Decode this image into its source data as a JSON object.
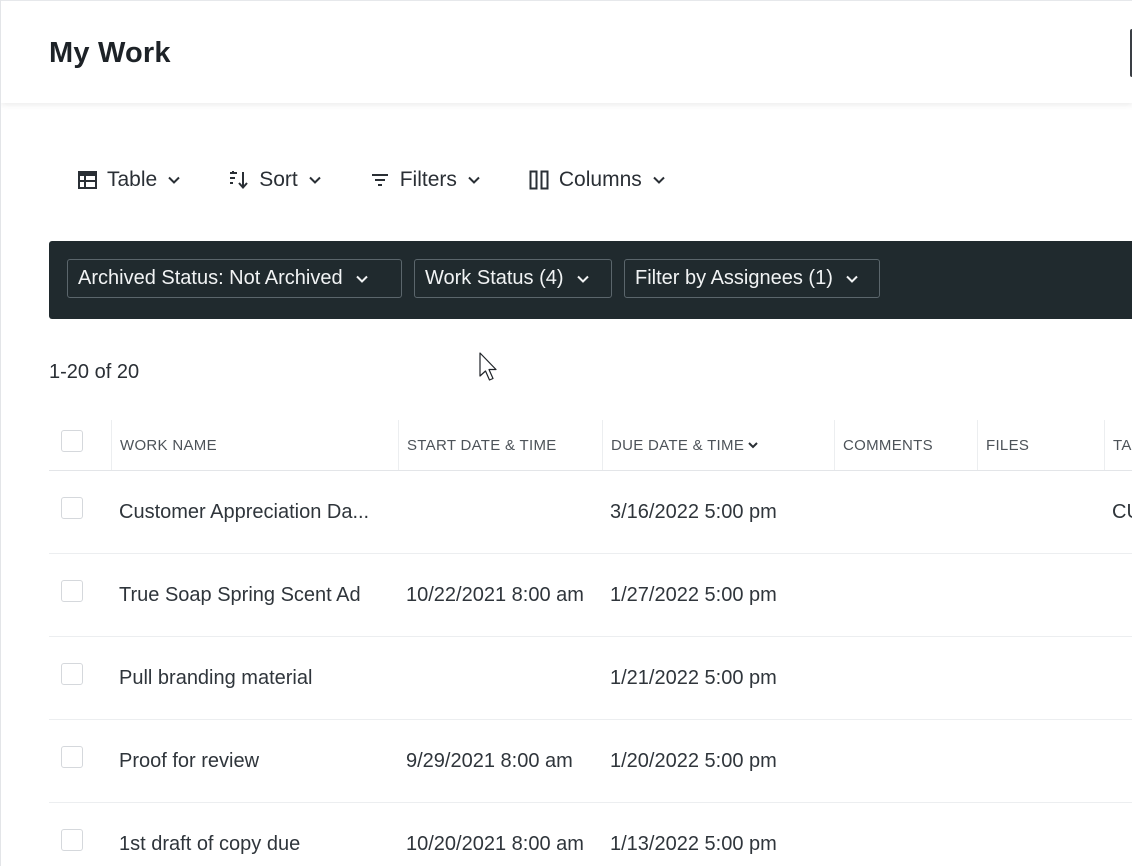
{
  "header": {
    "title": "My Work"
  },
  "toolbar": {
    "table_label": "Table",
    "sort_label": "Sort",
    "filters_label": "Filters",
    "columns_label": "Columns"
  },
  "filters": {
    "archived": "Archived Status: Not Archived",
    "work_status": "Work Status (4)",
    "assignees": "Filter by Assignees (1)"
  },
  "count": "1-20 of 20",
  "table": {
    "columns": [
      "WORK NAME",
      "START DATE & TIME",
      "DUE DATE & TIME",
      "COMMENTS",
      "FILES",
      "TAG"
    ],
    "rows": [
      {
        "name": "Customer Appreciation Da...",
        "start": "",
        "due": "3/16/2022 5:00 pm",
        "comments": "",
        "files": "",
        "tags": "CU"
      },
      {
        "name": "True Soap Spring Scent Ad",
        "start": "10/22/2021 8:00 am",
        "due": "1/27/2022 5:00 pm",
        "comments": "",
        "files": "",
        "tags": ""
      },
      {
        "name": "Pull branding material",
        "start": "",
        "due": "1/21/2022 5:00 pm",
        "comments": "",
        "files": "",
        "tags": ""
      },
      {
        "name": "Proof for review",
        "start": "9/29/2021 8:00 am",
        "due": "1/20/2022 5:00 pm",
        "comments": "",
        "files": "",
        "tags": ""
      },
      {
        "name": "1st draft of copy due",
        "start": "10/20/2021 8:00 am",
        "due": "1/13/2022 5:00 pm",
        "comments": "",
        "files": "",
        "tags": ""
      }
    ]
  },
  "colors": {
    "filter_bar_bg": "#202a2e",
    "text": "#2f353b"
  }
}
